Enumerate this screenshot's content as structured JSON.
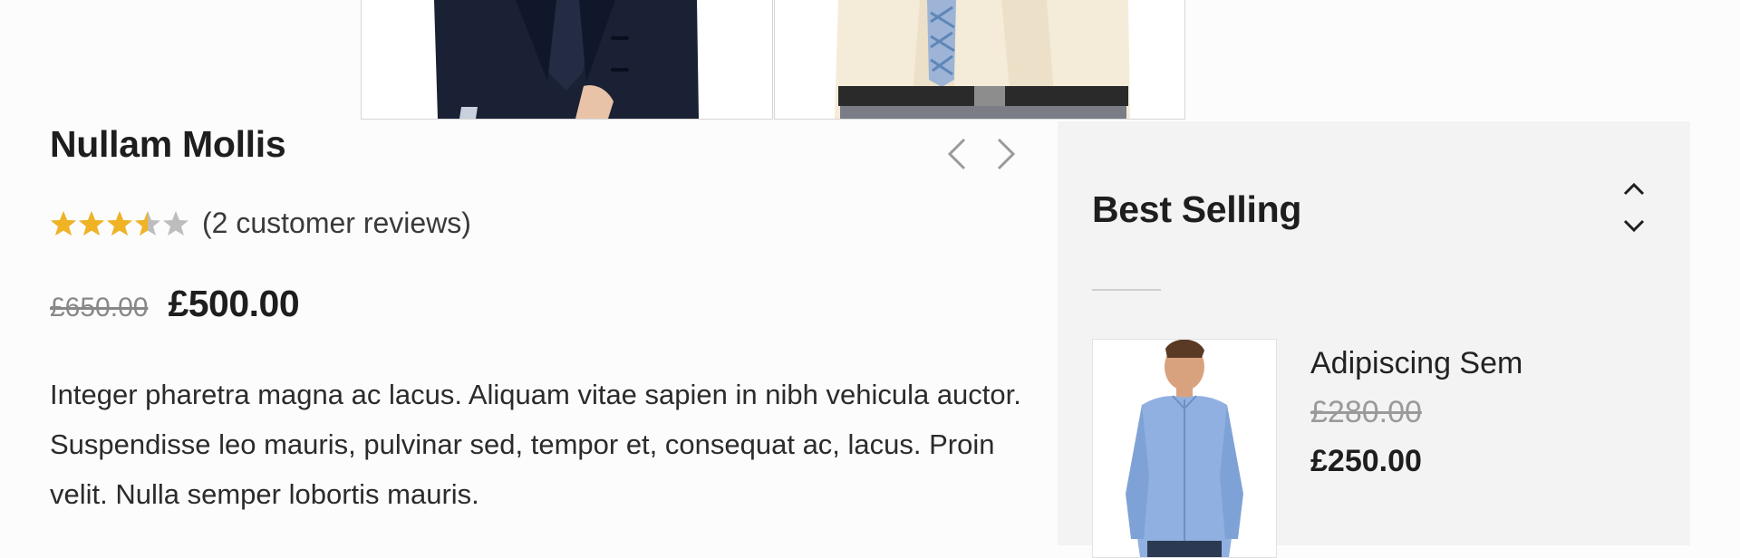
{
  "gallery": {
    "thumbnails": [
      {
        "image": "man-in-navy-suit-photo"
      },
      {
        "image": "man-in-cream-shirt-and-tie-photo"
      }
    ]
  },
  "product": {
    "title": "Nullam Mollis",
    "rating": 3.5,
    "rating_max": 5,
    "reviews_text": "(2 customer reviews)",
    "old_price": "£650.00",
    "price": "£500.00",
    "description": "Integer pharetra magna ac lacus. Aliquam vitae sapien in nibh vehicula auctor. Suspendisse leo mauris, pulvinar sed, tempor et, consequat ac, lacus. Proin velit. Nulla semper lobortis mauris."
  },
  "product_nav": {
    "prev_icon": "chevron-left-icon",
    "next_icon": "chevron-right-icon"
  },
  "sidebar": {
    "title": "Best Selling",
    "up_icon": "chevron-up-icon",
    "down_icon": "chevron-down-icon",
    "items": [
      {
        "name": "Adipiscing Sem",
        "old_price": "£280.00",
        "price": "£250.00",
        "image": "man-in-blue-shirt-photo"
      }
    ]
  },
  "colors": {
    "star_filled": "#f0b323",
    "star_empty": "#bdbdbd",
    "sidebar_bg": "#f3f3f3"
  }
}
